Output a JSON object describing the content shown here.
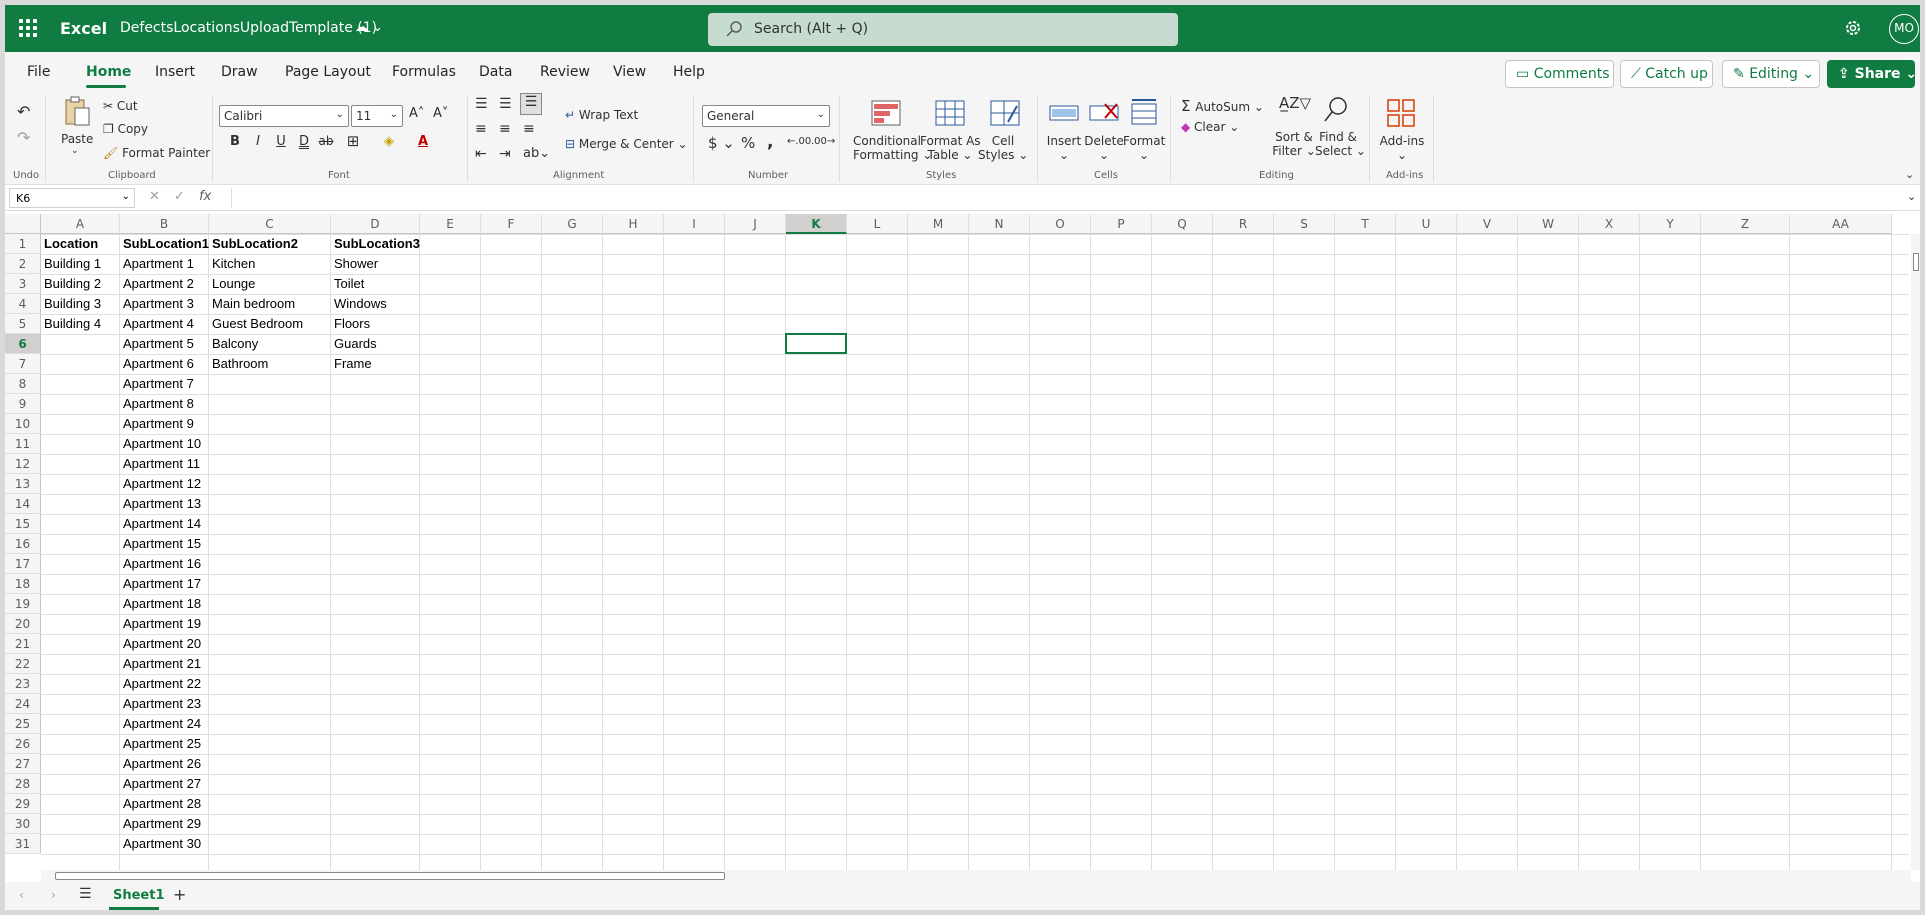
{
  "titlebar": {
    "app_name": "Excel",
    "doc_name": "DefectsLocationsUploadTemplate (1)",
    "search_placeholder": "Search (Alt + Q)",
    "avatar_initials": "MO",
    "brand_color": "#107c41"
  },
  "menu": {
    "tabs": [
      "File",
      "Home",
      "Insert",
      "Draw",
      "Page Layout",
      "Formulas",
      "Data",
      "Review",
      "View",
      "Help"
    ],
    "active_tab": "Home",
    "comments_label": "Comments",
    "catchup_label": "Catch up",
    "editing_label": "Editing",
    "share_label": "Share"
  },
  "ribbon": {
    "undo_group": "Undo",
    "paste_label": "Paste",
    "cut_label": "Cut",
    "copy_label": "Copy",
    "format_painter_label": "Format Painter",
    "clipboard_group": "Clipboard",
    "font_name": "Calibri",
    "font_size": "11",
    "font_group": "Font",
    "wrap_text_label": "Wrap Text",
    "merge_center_label": "Merge & Center",
    "alignment_group": "Alignment",
    "number_format": "General",
    "number_group": "Number",
    "conditional_formatting_1": "Conditional",
    "conditional_formatting_2": "Formatting",
    "format_as_table_1": "Format As",
    "format_as_table_2": "Table",
    "cell_styles_1": "Cell",
    "cell_styles_2": "Styles",
    "styles_group": "Styles",
    "insert_label": "Insert",
    "delete_label": "Delete",
    "format_label": "Format",
    "cells_group": "Cells",
    "autosum_label": "AutoSum",
    "clear_label": "Clear",
    "sort_filter_1": "Sort &",
    "sort_filter_2": "Filter",
    "find_select_1": "Find &",
    "find_select_2": "Select",
    "editing_group": "Editing",
    "addins_label": "Add-ins",
    "addins_group": "Add-ins"
  },
  "formula_bar": {
    "name_box": "K6",
    "fx_label": "fx"
  },
  "grid": {
    "columns": [
      "A",
      "B",
      "C",
      "D",
      "E",
      "F",
      "G",
      "H",
      "I",
      "J",
      "K",
      "L",
      "M",
      "N",
      "O",
      "P",
      "Q",
      "R",
      "S",
      "T",
      "U",
      "V",
      "W",
      "X",
      "Y",
      "Z",
      "AA"
    ],
    "rows": [
      "1",
      "2",
      "3",
      "4",
      "5",
      "6",
      "7",
      "8",
      "9",
      "10",
      "11",
      "12",
      "13",
      "14",
      "15",
      "16",
      "17",
      "18",
      "19",
      "20",
      "21",
      "22",
      "23",
      "24",
      "25",
      "26",
      "27",
      "28",
      "29",
      "30",
      "31"
    ],
    "selected_cell": "K6",
    "col_a": [
      "Location",
      "Building 1",
      "Building 2",
      "Building 3",
      "Building 4"
    ],
    "col_b": [
      "SubLocation1",
      "Apartment 1",
      "Apartment 2",
      "Apartment 3",
      "Apartment 4",
      "Apartment 5",
      "Apartment 6",
      "Apartment 7",
      "Apartment 8",
      "Apartment 9",
      "Apartment 10",
      "Apartment 11",
      "Apartment 12",
      "Apartment 13",
      "Apartment 14",
      "Apartment 15",
      "Apartment 16",
      "Apartment 17",
      "Apartment 18",
      "Apartment 19",
      "Apartment 20",
      "Apartment 21",
      "Apartment 22",
      "Apartment 23",
      "Apartment 24",
      "Apartment 25",
      "Apartment 26",
      "Apartment 27",
      "Apartment 28",
      "Apartment 29",
      "Apartment 30"
    ],
    "col_c": [
      "SubLocation2",
      "Kitchen",
      "Lounge",
      "Main bedroom",
      "Guest Bedroom",
      "Balcony",
      "Bathroom"
    ],
    "col_d": [
      "SubLocation3",
      "Shower",
      "Toilet",
      "Windows",
      "Floors",
      "Guards",
      "Frame"
    ]
  },
  "sheets": {
    "tabs": [
      "Sheet1"
    ],
    "active": "Sheet1"
  }
}
